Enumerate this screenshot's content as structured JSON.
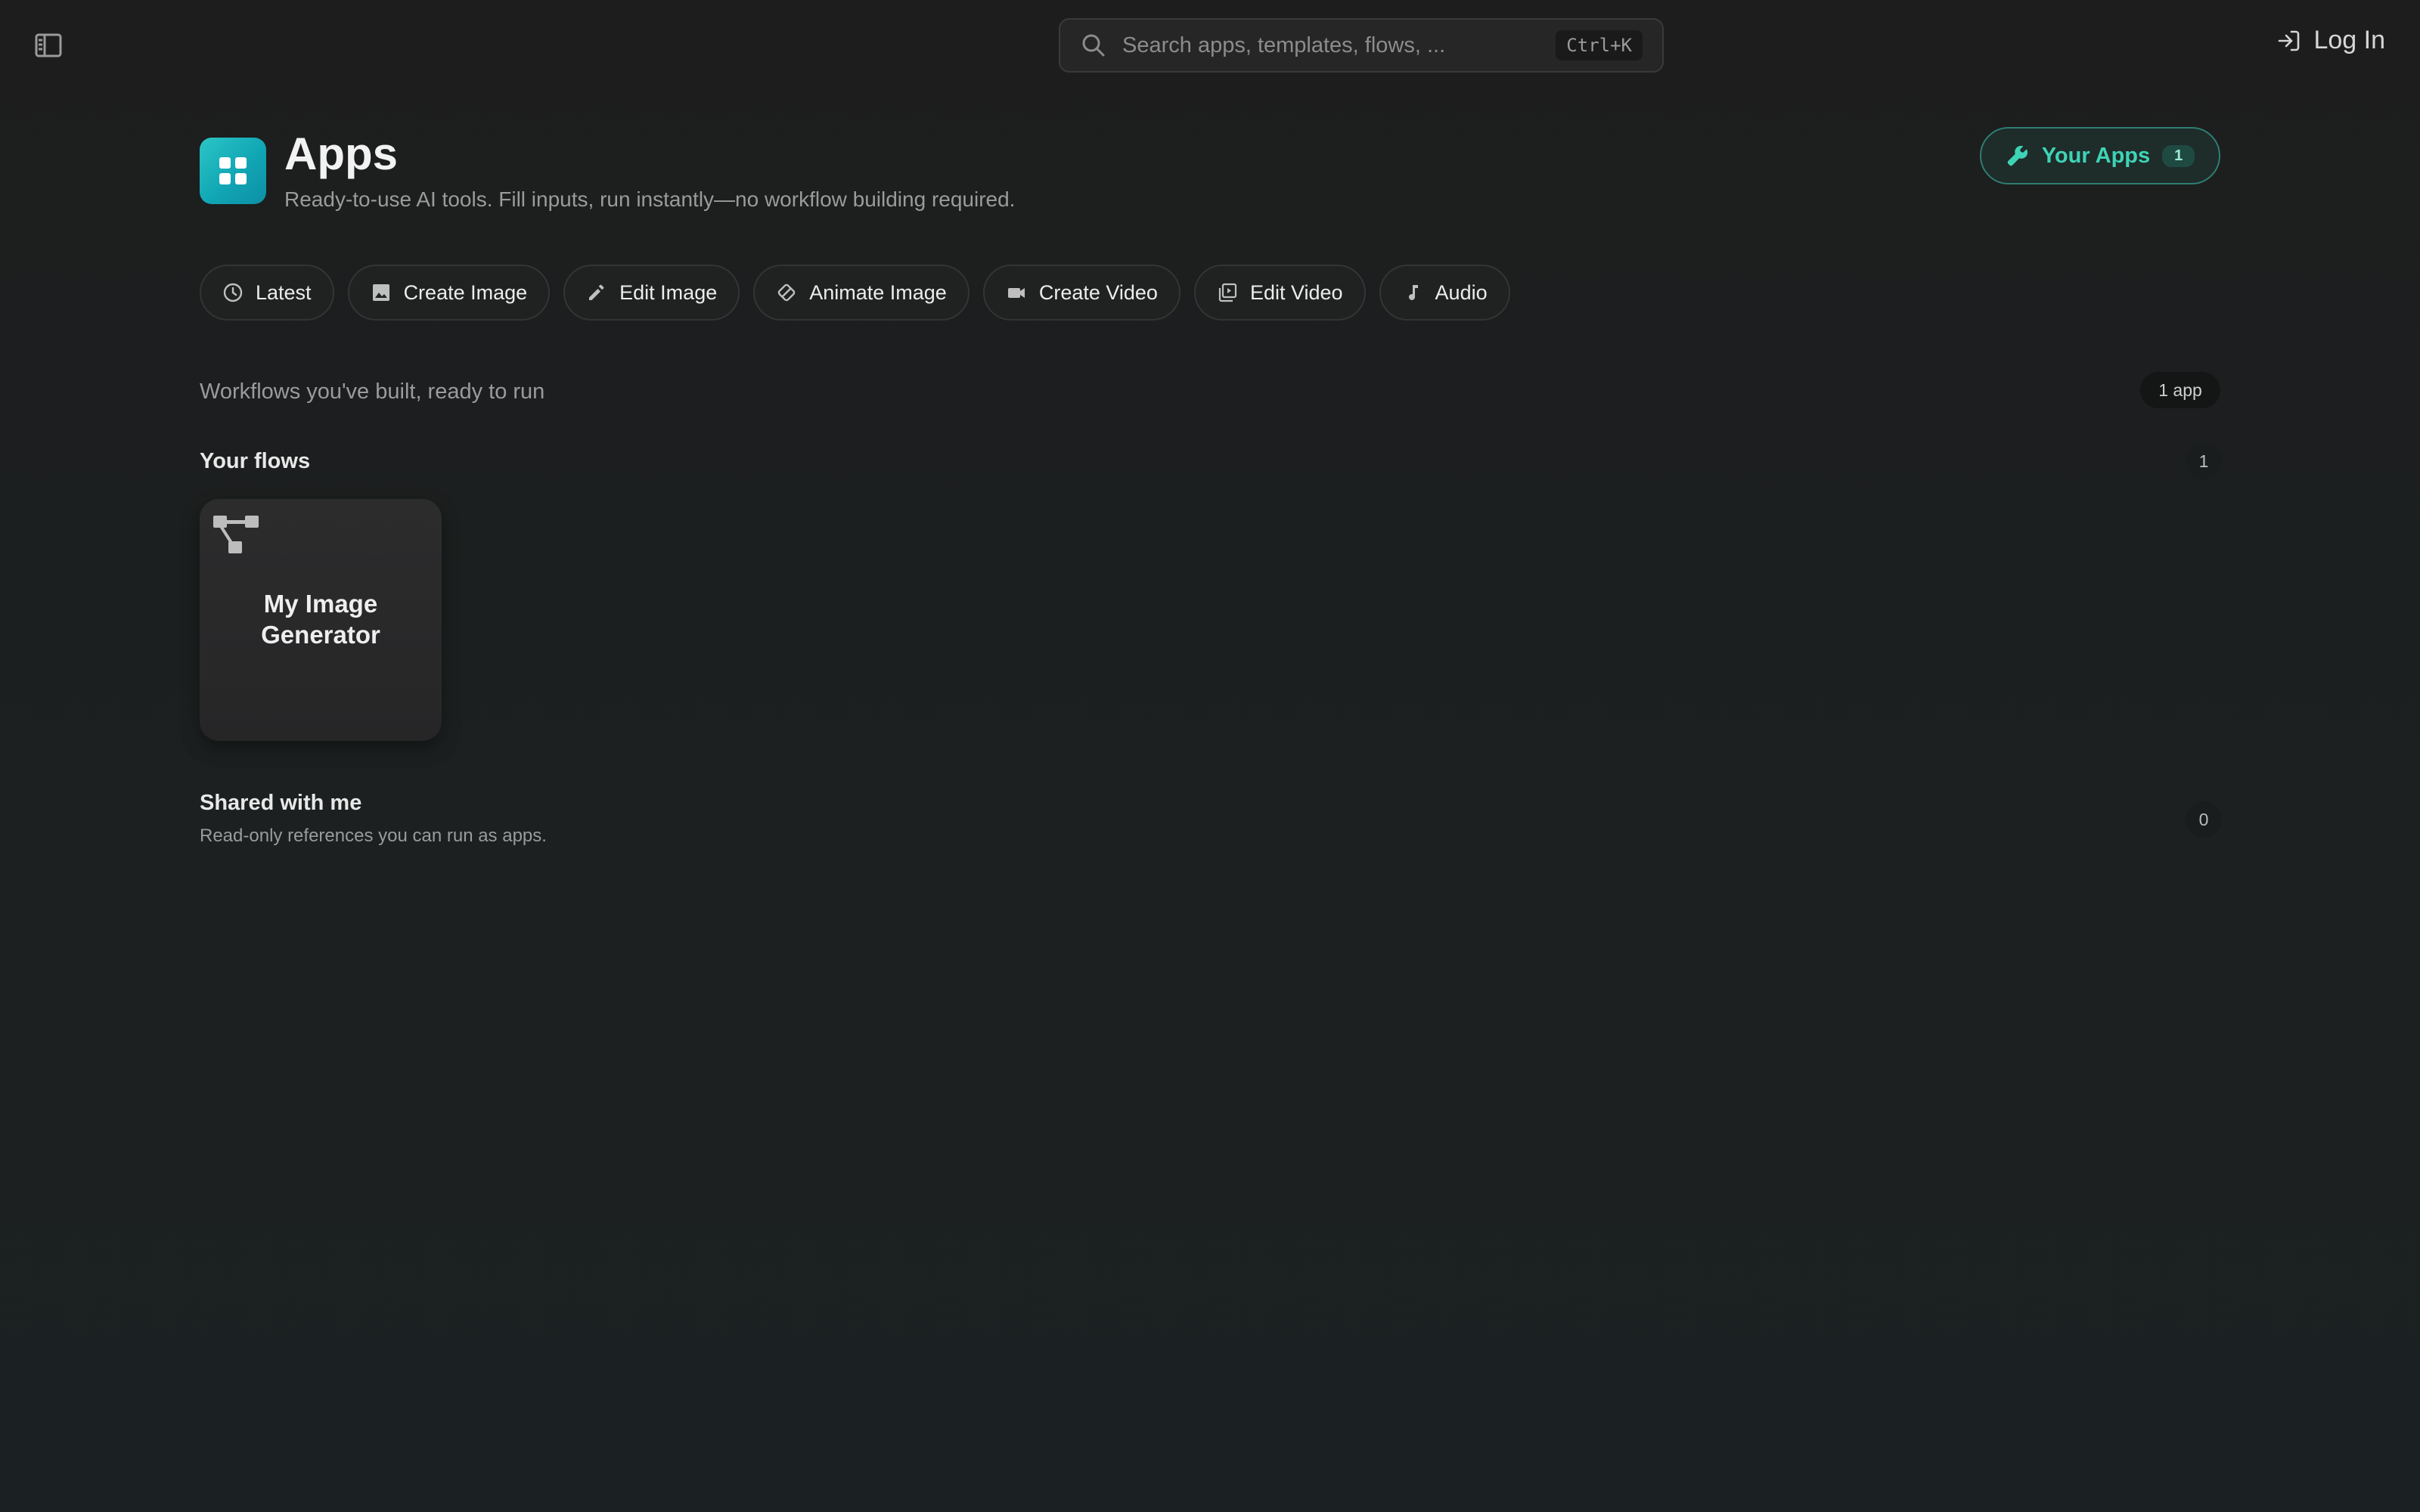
{
  "topbar": {
    "sidebar_toggle_icon": "sidebar-toggle-icon",
    "search_placeholder": "Search apps, templates, flows, ...",
    "search_shortcut": "Ctrl+K",
    "login_label": "Log In"
  },
  "header": {
    "title": "Apps",
    "subtitle": "Ready-to-use AI tools. Fill inputs, run instantly—no workflow building required.",
    "icon": "grid-icon",
    "your_apps_label": "Your Apps",
    "your_apps_count": "1"
  },
  "categories": [
    {
      "label": "Latest",
      "icon": "clock-icon"
    },
    {
      "label": "Create Image",
      "icon": "image-icon"
    },
    {
      "label": "Edit Image",
      "icon": "pencil-icon"
    },
    {
      "label": "Animate Image",
      "icon": "animate-icon"
    },
    {
      "label": "Create Video",
      "icon": "video-camera-icon"
    },
    {
      "label": "Edit Video",
      "icon": "video-library-icon"
    },
    {
      "label": "Audio",
      "icon": "music-note-icon"
    }
  ],
  "workflows": {
    "caption": "Workflows you've built, ready to run",
    "app_count": "1 app"
  },
  "your_flows": {
    "heading": "Your flows",
    "count": "1",
    "items": [
      {
        "title": "My Image Generator",
        "icon": "flow-icon"
      }
    ]
  },
  "shared": {
    "heading": "Shared with me",
    "subtitle": "Read-only references you can run as apps.",
    "count": "0"
  },
  "colors": {
    "accent": "#3fd3b6",
    "brand_gradient_start": "#2bc6c6",
    "brand_gradient_end": "#0d8fa6",
    "background": "#1d1f1f"
  }
}
